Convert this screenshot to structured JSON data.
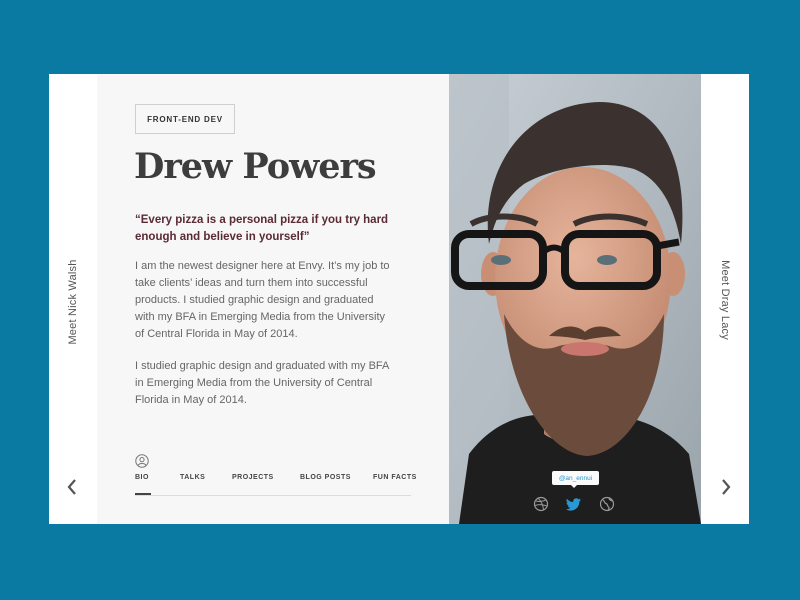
{
  "nav": {
    "prev_label": "Meet Nick Walsh",
    "next_label": "Meet Dray Lacy"
  },
  "profile": {
    "role": "FRONT-END DEV",
    "name": "Drew Powers",
    "quote": "“Every pizza is a personal pizza if you try hard enough and believe in yourself”",
    "bio_paragraphs": [
      "I am the newest designer here at Envy. It’s my job to take clients’ ideas and turn them into successful products. I studied graphic design and graduated with my BFA in Emerging Media from the University of Central Florida in May of 2014.",
      "I studied graphic design and graduated with my BFA in Emerging Media from the University of Central Florida in May of 2014."
    ]
  },
  "tabs": [
    {
      "label": "BIO",
      "active": true
    },
    {
      "label": "TALKS",
      "active": false
    },
    {
      "label": "PROJECTS",
      "active": false
    },
    {
      "label": "BLOG POSTS",
      "active": false
    },
    {
      "label": "FUN FACTS",
      "active": false
    }
  ],
  "social": {
    "tooltip": "@an_ennui",
    "icons": [
      "dribbble-icon",
      "twitter-icon",
      "globe-icon"
    ]
  },
  "colors": {
    "background": "#0b7aa3",
    "quote": "#5a2a35",
    "twitter": "#2a98d4"
  }
}
